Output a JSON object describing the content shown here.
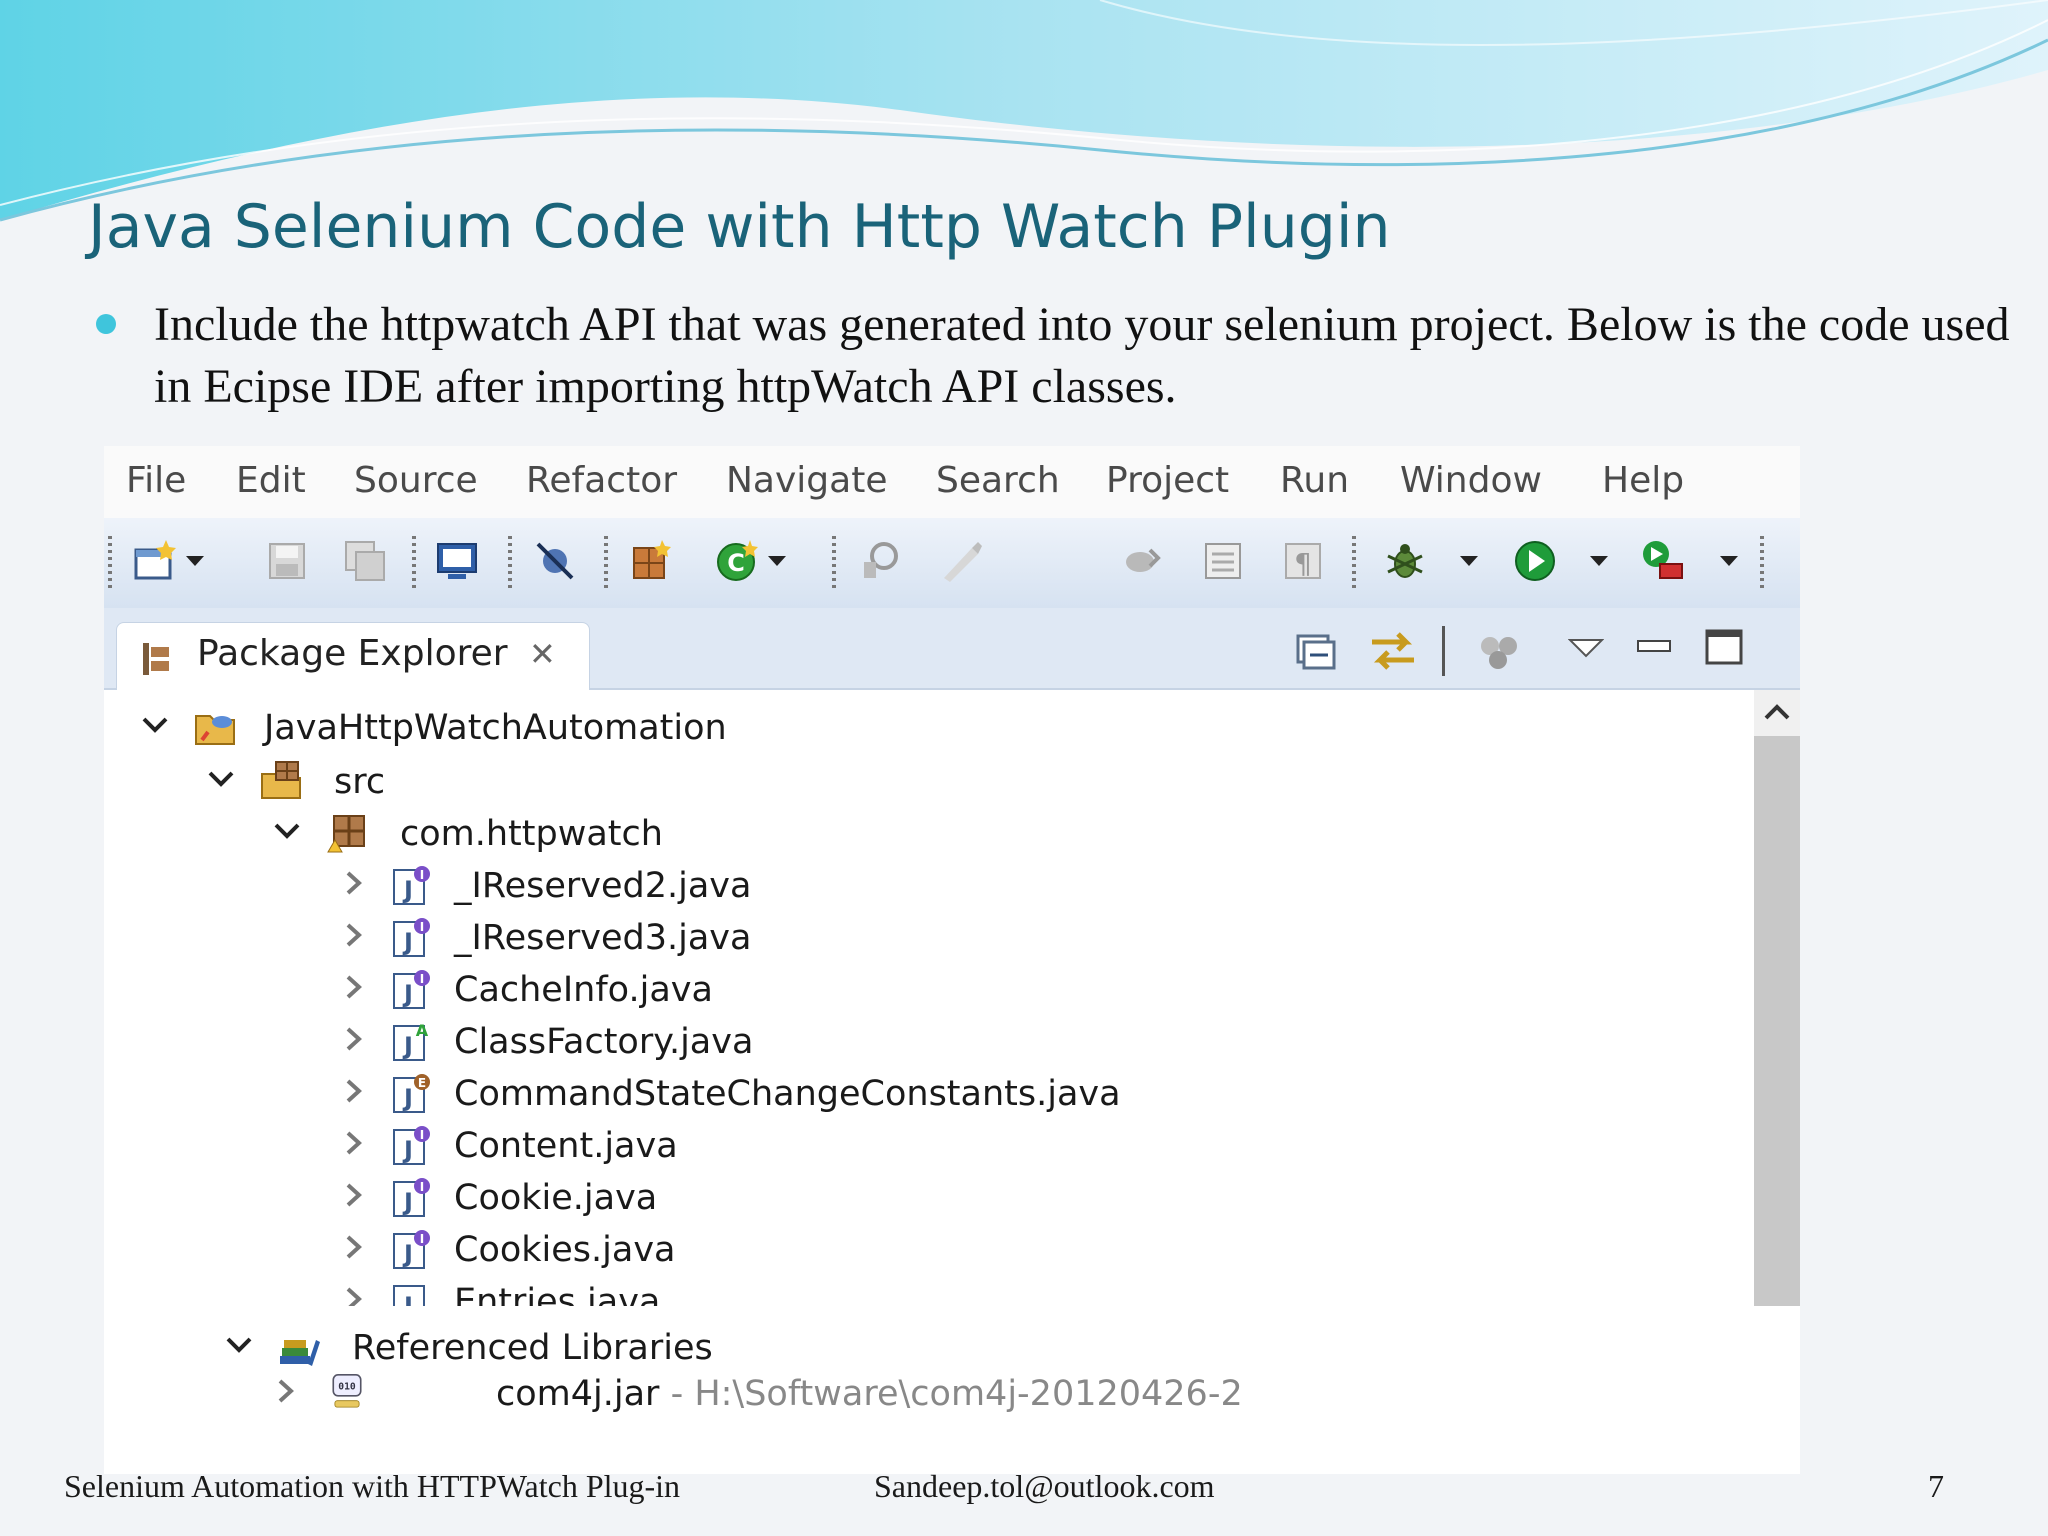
{
  "slide": {
    "title": "Java Selenium Code with Http Watch Plugin",
    "bullet": "Include the httpwatch API that was generated into  your selenium project. Below is the code used in Ecipse IDE after importing  httpWatch API classes.",
    "footer_left": "Selenium Automation with HTTPWatch Plug-in",
    "footer_center": "Sandeep.tol@outlook.com",
    "page_number": "7",
    "accent_color": "#3fc5dc",
    "title_color": "#1a6379"
  },
  "eclipse": {
    "menu": [
      "File",
      "Edit",
      "Source",
      "Refactor",
      "Navigate",
      "Search",
      "Project",
      "Run",
      "Window",
      "Help"
    ],
    "toolbar_icons": [
      "new-wizard-icon",
      "save-icon",
      "save-all-icon",
      "open-console-icon",
      "skip-breakpoints-icon",
      "new-java-package-icon",
      "new-java-class-icon",
      "open-type-icon",
      "pen-icon",
      "toggle-mark-icon",
      "block-selection-icon",
      "show-whitespace-icon",
      "debug-icon",
      "run-icon",
      "run-external-tools-icon",
      "open-folder-icon",
      "open-folder-icon-2"
    ],
    "view": {
      "title": "Package Explorer",
      "close_glyph": "✕",
      "action_icons": [
        "collapse-all-icon",
        "link-with-editor-icon",
        "filters-icon",
        "view-menu-icon",
        "minimize-icon",
        "maximize-icon"
      ]
    },
    "tree": [
      {
        "label": "JavaHttpWatchAutomation",
        "icon": "java-project-icon",
        "expanded": true
      },
      {
        "label": "src",
        "icon": "source-folder-icon",
        "expanded": true
      },
      {
        "label": "com.httpwatch",
        "icon": "package-icon",
        "expanded": true
      },
      {
        "label": "_IReserved2.java",
        "icon": "java-interface-file-icon",
        "expanded": false
      },
      {
        "label": "_IReserved3.java",
        "icon": "java-interface-file-icon",
        "expanded": false
      },
      {
        "label": "CacheInfo.java",
        "icon": "java-interface-file-icon",
        "expanded": false
      },
      {
        "label": "ClassFactory.java",
        "icon": "java-abstract-file-icon",
        "expanded": false
      },
      {
        "label": "CommandStateChangeConstants.java",
        "icon": "java-enum-file-icon",
        "expanded": false
      },
      {
        "label": "Content.java",
        "icon": "java-interface-file-icon",
        "expanded": false
      },
      {
        "label": "Cookie.java",
        "icon": "java-interface-file-icon",
        "expanded": false
      },
      {
        "label": "Cookies.java",
        "icon": "java-interface-file-icon",
        "expanded": false
      },
      {
        "label": "Entries.java",
        "icon": "java-interface-file-icon",
        "expanded": false
      }
    ],
    "libraries": {
      "label": "Referenced Libraries",
      "jar_label": "com4j.jar",
      "jar_path": " - H:\\Software\\com4j-20120426-2"
    }
  }
}
